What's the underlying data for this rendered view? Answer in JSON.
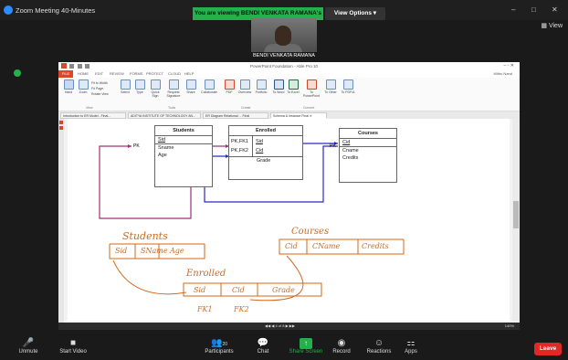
{
  "window": {
    "title": "Zoom Meeting 40-Minutes",
    "banner": "You are viewing BENDI VENKATA RAMANA's screen",
    "view_options": "View Options",
    "view_label": "View",
    "controls": [
      "–",
      "□",
      "✕"
    ]
  },
  "video": {
    "participant_name": "BENDI VENKATA RAMANA"
  },
  "shared_app": {
    "title": "PowerPoint Foundation - Able Pro 10",
    "menu_tabs": [
      "FILE",
      "HOME",
      "EDIT",
      "REVIEW",
      "FORMS",
      "PROTECT",
      "CLOUD",
      "HELP"
    ],
    "user": "Mithu Nand",
    "ribbon": {
      "buttons": [
        "Hand",
        "Zoom",
        "Select",
        "Type",
        "Quick Sign",
        "Request Signature",
        "Share",
        "Collaborate",
        "PDF",
        "Overview",
        "Portfolio",
        "To Word",
        "To Excel",
        "To PowerPoint",
        "To Other",
        "To PDF/A"
      ],
      "small_buttons": [
        "Fit to Width",
        "Fit Page",
        "Rotate View"
      ],
      "groups": [
        "View",
        "Tools",
        "Create",
        "Convert"
      ]
    },
    "doc_tabs": [
      "Introduction to ER Model - Final...",
      "ADITYA INSTITUTE OF TECHNOLOGY AN...",
      "ER Diagram Relational ... Final",
      "Schema & Instance Final"
    ],
    "status_page": "4 of 8",
    "status_zoom": "140%"
  },
  "diagram": {
    "students": {
      "title": "Students",
      "pk": "PK",
      "fields": [
        "Sid",
        "Sname",
        "Age"
      ]
    },
    "enrolled": {
      "title": "Enrolled",
      "keys": [
        "PK,FK1",
        "PK,FK2"
      ],
      "fields": [
        "Sid",
        "Cid",
        "Grade"
      ]
    },
    "courses": {
      "title": "Courses",
      "pk": "PK",
      "fields": [
        "Cid",
        "Cname",
        "Credits"
      ]
    }
  },
  "handwriting": {
    "students_label": "Students",
    "students_cols": [
      "Sid",
      "SName",
      "Age"
    ],
    "courses_label": "Courses",
    "courses_cols": [
      "Cid",
      "CName",
      "Credits"
    ],
    "enrolled_label": "Enrolled",
    "enrolled_cols": [
      "Sid",
      "Cid",
      "Grade"
    ],
    "fk1": "FK1",
    "fk2": "FK2"
  },
  "controls": {
    "unmute": "Unmute",
    "start_video": "Start Video",
    "participants": "Participants",
    "participants_count": "20",
    "chat": "Chat",
    "share_screen": "Share Screen",
    "record": "Record",
    "reactions": "Reactions",
    "apps": "Apps",
    "leave": "Leave"
  },
  "colors": {
    "accent_green": "#22b14c",
    "leave_red": "#e02828",
    "handwriting": "#d2691e",
    "connector_purple": "#a0307a",
    "connector_blue": "#2a2ac8"
  }
}
